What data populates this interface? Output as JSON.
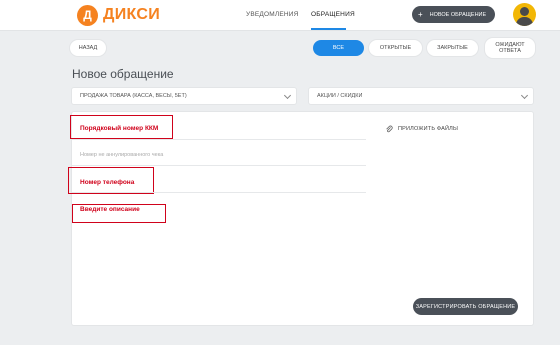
{
  "header": {
    "logo_letter": "Д",
    "logo_text": "ДИКСИ",
    "nav": [
      {
        "label": "УВЕДОМЛЕНИЯ"
      },
      {
        "label": "ОБРАЩЕНИЯ"
      }
    ],
    "new_button": {
      "icon": "+",
      "label": "НОВОЕ ОБРАЩЕНИЕ"
    }
  },
  "toolbar": {
    "back_label": "НАЗАД",
    "filters": [
      {
        "label": "ВСЕ",
        "active": true
      },
      {
        "label": "ОТКРЫТЫЕ",
        "active": false
      },
      {
        "label": "ЗАКРЫТЫЕ",
        "active": false
      },
      {
        "label": "ОЖИДАЮТ ОТВЕТА",
        "active": false
      }
    ]
  },
  "page": {
    "title": "Новое обращение"
  },
  "selects": {
    "category": "ПРОДАЖА ТОВАРА (КАССА, ВЕСЫ, 5ЕТ)",
    "subcategory": "АКЦИИ / СКИДКИ"
  },
  "form": {
    "kkm_label": "Порядковый номер ККМ",
    "receipt_placeholder": "Номер не аннулированного чека",
    "phone_label": "Номер телефона",
    "description_label": "Введите описание",
    "attach_label": "ПРИЛОЖИТЬ ФАЙЛЫ",
    "submit_label": "ЗАРЕГИСТРИРОВАТЬ ОБРАЩЕНИЕ"
  },
  "colors": {
    "brand": "#f58220",
    "accent": "#1e88e5",
    "highlight": "#d0021b",
    "dark_button": "#4a5058"
  },
  "icons": {
    "attach": "paperclip-icon",
    "avatar": "user-avatar-icon",
    "select": "chevron-down-icon"
  }
}
